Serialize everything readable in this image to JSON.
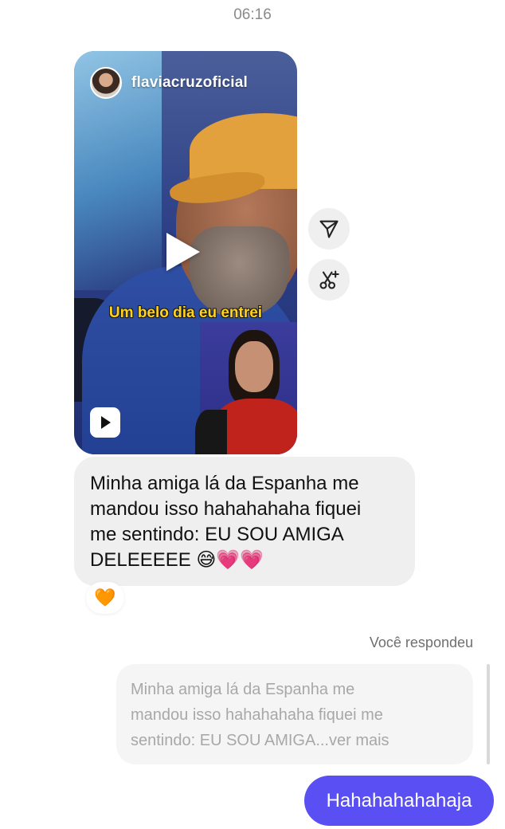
{
  "timestamp": "06:16",
  "reel": {
    "author": "flaviacruzoficial",
    "caption": "Um belo dia eu entrei"
  },
  "side_actions": [
    {
      "icon": "share-icon"
    },
    {
      "icon": "remix-icon"
    }
  ],
  "messages": {
    "received_line1": "Minha amiga lá da Espanha me",
    "received_line2": "mandou isso hahahahaha fiquei",
    "received_line3": "me sentindo: EU SOU AMIGA",
    "received_line4": "DELEEEEE 😅💗💗",
    "reaction": "🧡",
    "replied_label": "Você respondeu",
    "quoted_line1": "Minha amiga lá da Espanha me",
    "quoted_line2": "mandou isso hahahahaha fiquei me",
    "quoted_line3": "sentindo: EU SOU AMIGA...ver mais",
    "sent": "Hahahahahahaja"
  },
  "colors": {
    "sent_bubble": "#5a4ff2",
    "received_bubble": "#efefef",
    "caption": "#ffd21f"
  }
}
